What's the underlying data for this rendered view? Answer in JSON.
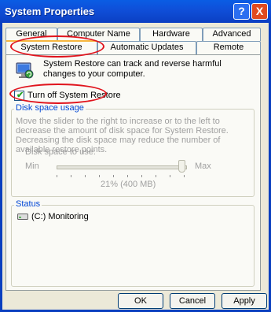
{
  "window": {
    "title": "System Properties"
  },
  "titlebar": {
    "help_label": "?",
    "close_label": "X"
  },
  "tabs": {
    "row1": [
      "General",
      "Computer Name",
      "Hardware",
      "Advanced"
    ],
    "row2": [
      "System Restore",
      "Automatic Updates",
      "Remote"
    ],
    "active": "System Restore"
  },
  "restore": {
    "description": "System Restore can track and reverse harmful changes to your computer.",
    "checkbox_label": "Turn off System Restore",
    "checkbox_checked": true
  },
  "disk_space": {
    "title": "Disk space usage",
    "description": "Move the slider to the right to increase or to the left to decrease the amount of disk space for System Restore. Decreasing the disk space may reduce the number of available restore points.",
    "slider_label": "Disk space to use:",
    "min_label": "Min",
    "max_label": "Max",
    "value_text": "21% (400 MB)",
    "slider_fraction": 0.97
  },
  "status": {
    "title": "Status",
    "drive_text": "(C:) Monitoring"
  },
  "buttons": {
    "ok": "OK",
    "cancel": "Cancel",
    "apply": "Apply"
  },
  "colors": {
    "annotation": "#e0141d",
    "titlebar": "#0b3fc2",
    "group_label": "#0046d5"
  }
}
